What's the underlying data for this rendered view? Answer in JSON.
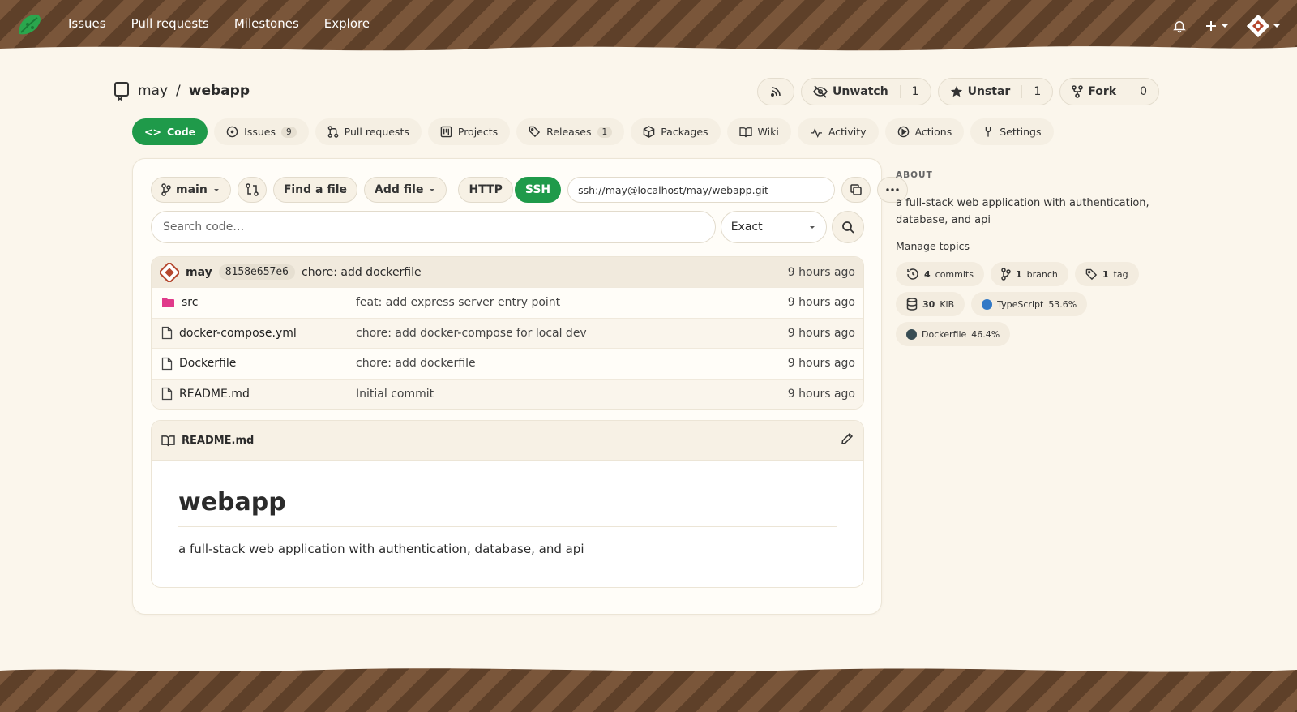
{
  "topnav": {
    "items": [
      "Issues",
      "Pull requests",
      "Milestones",
      "Explore"
    ]
  },
  "repo": {
    "owner": "may",
    "separator": "/",
    "name": "webapp"
  },
  "actions": {
    "watch_label": "Unwatch",
    "watch_count": "1",
    "star_label": "Unstar",
    "star_count": "1",
    "fork_label": "Fork",
    "fork_count": "0"
  },
  "tabs": [
    {
      "label": "Code"
    },
    {
      "label": "Issues",
      "badge": "9"
    },
    {
      "label": "Pull requests"
    },
    {
      "label": "Projects"
    },
    {
      "label": "Releases",
      "badge": "1"
    },
    {
      "label": "Packages"
    },
    {
      "label": "Wiki"
    },
    {
      "label": "Activity"
    },
    {
      "label": "Actions"
    },
    {
      "label": "Settings"
    }
  ],
  "toolbar": {
    "branch": "main",
    "find_file": "Find a file",
    "add_file": "Add file",
    "http": "HTTP",
    "ssh": "SSH",
    "clone_url": "ssh://may@localhost/may/webapp.git"
  },
  "search": {
    "placeholder": "Search code…",
    "mode": "Exact"
  },
  "latest_commit": {
    "author": "may",
    "sha": "8158e657e6",
    "message": "chore: add dockerfile",
    "time": "9 hours ago"
  },
  "files": [
    {
      "name": "src",
      "type": "folder",
      "message": "feat: add express server entry point",
      "time": "9 hours ago"
    },
    {
      "name": "docker-compose.yml",
      "type": "file",
      "message": "chore: add docker-compose for local dev",
      "time": "9 hours ago"
    },
    {
      "name": "Dockerfile",
      "type": "file",
      "message": "chore: add dockerfile",
      "time": "9 hours ago"
    },
    {
      "name": "README.md",
      "type": "file",
      "message": "Initial commit",
      "time": "9 hours ago"
    }
  ],
  "readme": {
    "filename": "README.md",
    "heading": "webapp",
    "body": "a full-stack web application with authentication, database, and api"
  },
  "sidebar": {
    "about_heading": "ABOUT",
    "description": "a full-stack web application with authentication, database, and api",
    "manage_topics": "Manage topics",
    "commits_count": "4",
    "commits_label": "commits",
    "branch_count": "1",
    "branch_label": "branch",
    "tag_count": "1",
    "tag_label": "tag",
    "size_value": "30",
    "size_unit": "KiB",
    "languages": [
      {
        "name": "TypeScript",
        "percent": "53.6%",
        "color": "#3178c6"
      },
      {
        "name": "Dockerfile",
        "percent": "46.4%",
        "color": "#384d54"
      }
    ]
  },
  "colors": {
    "accent_green": "#1f9a4a",
    "header_brown": "#6b4a31",
    "background": "#fbf6ec",
    "folder_pink": "#e03a8a"
  }
}
